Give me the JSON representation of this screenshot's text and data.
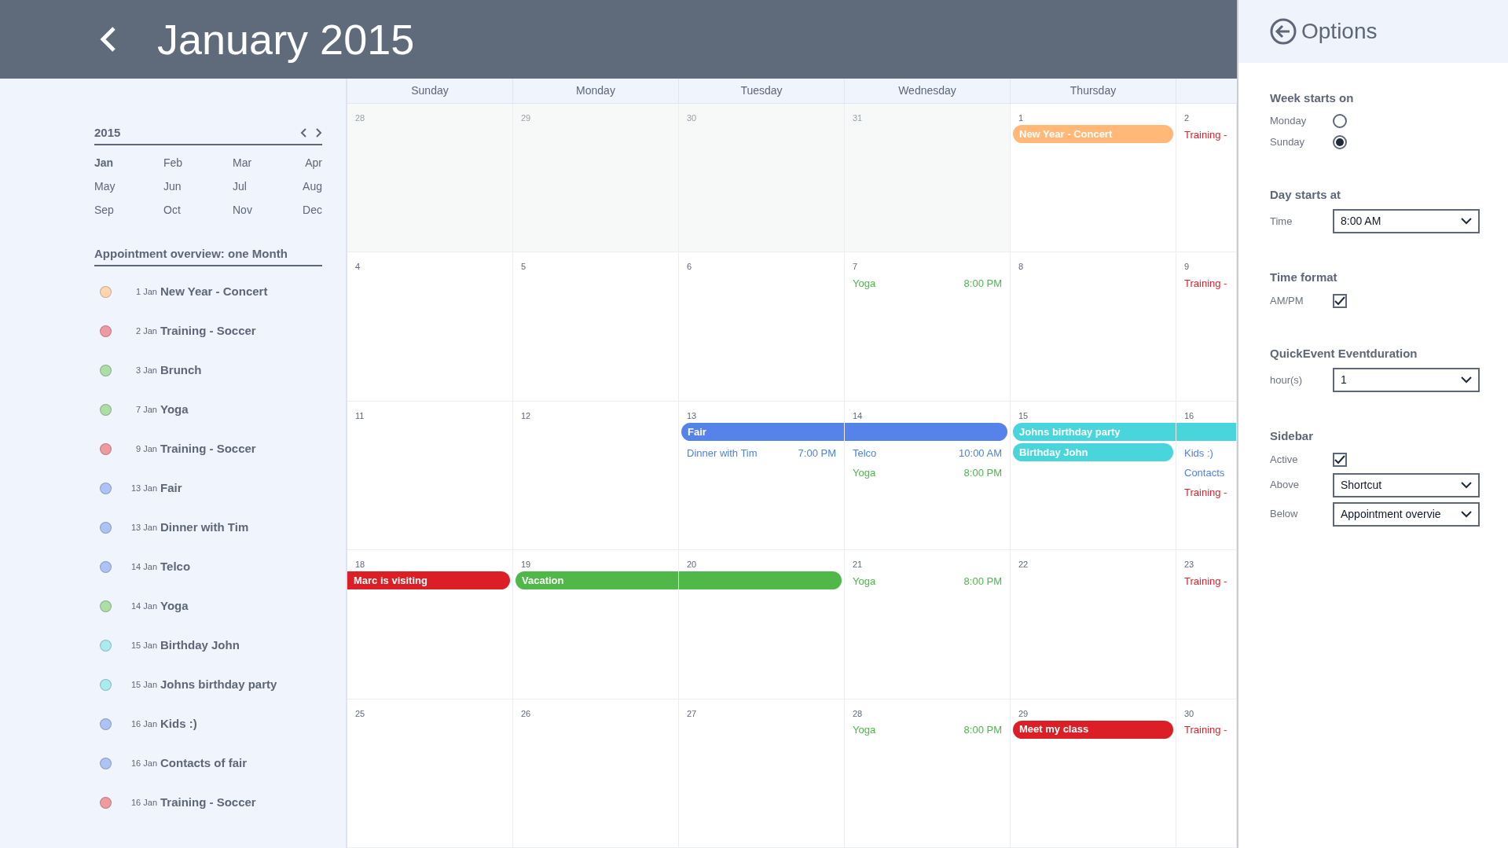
{
  "header": {
    "title": "January 2015"
  },
  "mini_calendar": {
    "year": "2015",
    "months": [
      {
        "label": "Jan",
        "selected": true
      },
      {
        "label": "Feb",
        "selected": false
      },
      {
        "label": "Mar",
        "selected": false
      },
      {
        "label": "Apr",
        "selected": false
      },
      {
        "label": "May",
        "selected": false
      },
      {
        "label": "Jun",
        "selected": false
      },
      {
        "label": "Jul",
        "selected": false
      },
      {
        "label": "Aug",
        "selected": false
      },
      {
        "label": "Sep",
        "selected": false
      },
      {
        "label": "Oct",
        "selected": false
      },
      {
        "label": "Nov",
        "selected": false
      },
      {
        "label": "Dec",
        "selected": false
      }
    ]
  },
  "overview": {
    "title": "Appointment overview: one Month",
    "items": [
      {
        "date": "1 Jan",
        "title": "New Year - Concert",
        "color": "#ffd6ad"
      },
      {
        "date": "2 Jan",
        "title": "Training - Soccer",
        "color": "#ef9aa0"
      },
      {
        "date": "3 Jan",
        "title": "Brunch",
        "color": "#acdea6"
      },
      {
        "date": "7 Jan",
        "title": "Yoga",
        "color": "#acdea6"
      },
      {
        "date": "9 Jan",
        "title": "Training - Soccer",
        "color": "#ef9aa0"
      },
      {
        "date": "13 Jan",
        "title": "Fair",
        "color": "#adc3f6"
      },
      {
        "date": "13 Jan",
        "title": "Dinner with Tim",
        "color": "#adc3f6"
      },
      {
        "date": "14 Jan",
        "title": "Telco",
        "color": "#adc3f6"
      },
      {
        "date": "14 Jan",
        "title": "Yoga",
        "color": "#acdea6"
      },
      {
        "date": "15 Jan",
        "title": "Birthday John",
        "color": "#a9ebee"
      },
      {
        "date": "15 Jan",
        "title": "Johns birthday party",
        "color": "#a9ebee"
      },
      {
        "date": "16 Jan",
        "title": "Kids :)",
        "color": "#adc3f6"
      },
      {
        "date": "16 Jan",
        "title": "Contacts of fair",
        "color": "#adc3f6"
      },
      {
        "date": "16 Jan",
        "title": "Training - Soccer",
        "color": "#ef9aa0"
      }
    ]
  },
  "calendar": {
    "weekdays": [
      "Sunday",
      "Monday",
      "Tuesday",
      "Wednesday",
      "Thursday"
    ],
    "weeks": [
      {
        "days": [
          {
            "number": "28",
            "outside": true
          },
          {
            "number": "29",
            "outside": true
          },
          {
            "number": "30",
            "outside": true
          },
          {
            "number": "31",
            "outside": true
          },
          {
            "number": "1",
            "outside": false,
            "events": [
              {
                "kind": "bar",
                "title": "New Year - Concert",
                "color": "#ffb877",
                "open_start": false,
                "open_end": false
              }
            ]
          },
          {
            "number": "2",
            "outside": false,
            "events": [
              {
                "kind": "timed",
                "title": "Training -",
                "color": "#e0202a"
              }
            ]
          }
        ]
      },
      {
        "days": [
          {
            "number": "4",
            "outside": false
          },
          {
            "number": "5",
            "outside": false
          },
          {
            "number": "6",
            "outside": false
          },
          {
            "number": "7",
            "outside": false,
            "events": [
              {
                "kind": "timed",
                "title": "Yoga",
                "time": "8:00 PM",
                "color": "#4cb848"
              }
            ]
          },
          {
            "number": "8",
            "outside": false
          },
          {
            "number": "9",
            "outside": false,
            "events": [
              {
                "kind": "timed",
                "title": "Training -",
                "color": "#e0202a"
              }
            ]
          }
        ]
      },
      {
        "days": [
          {
            "number": "11",
            "outside": false
          },
          {
            "number": "12",
            "outside": false
          },
          {
            "number": "13",
            "outside": false,
            "events": [
              {
                "kind": "bar",
                "title": "Fair",
                "color": "#5583ea",
                "open_start": false,
                "open_end": true
              },
              {
                "kind": "timed",
                "title": "Dinner with Tim",
                "time": "7:00 PM",
                "color": "#4f7fe6"
              }
            ]
          },
          {
            "number": "14",
            "outside": false,
            "events": [
              {
                "kind": "bar",
                "color": "#5583ea",
                "open_start": true,
                "open_end": false
              },
              {
                "kind": "timed",
                "title": "Telco",
                "time": "10:00 AM",
                "color": "#4f7fe6"
              },
              {
                "kind": "timed",
                "title": "Yoga",
                "time": "8:00 PM",
                "color": "#4cb848"
              }
            ]
          },
          {
            "number": "15",
            "outside": false,
            "events": [
              {
                "kind": "bar",
                "title": "Johns birthday party",
                "color": "#48d6dc",
                "open_start": false,
                "open_end": true
              },
              {
                "kind": "bar",
                "title": "Birthday John",
                "color": "#48d6dc",
                "open_start": false,
                "open_end": false
              }
            ]
          },
          {
            "number": "16",
            "outside": false,
            "events": [
              {
                "kind": "bar",
                "color": "#48d6dc",
                "open_start": true,
                "open_end": true
              },
              {
                "kind": "timed",
                "title": "Kids :)",
                "color": "#4f7fe6"
              },
              {
                "kind": "timed",
                "title": "Contacts",
                "color": "#4f7fe6"
              },
              {
                "kind": "timed",
                "title": "Training -",
                "color": "#e0202a"
              }
            ]
          }
        ]
      },
      {
        "days": [
          {
            "number": "18",
            "outside": false,
            "events": [
              {
                "kind": "bar",
                "title": "Marc is visiting",
                "color": "#dc1f26",
                "open_start": true,
                "open_end": false
              }
            ]
          },
          {
            "number": "19",
            "outside": false,
            "events": [
              {
                "kind": "bar",
                "title": "Vacation",
                "color": "#50b848",
                "open_start": false,
                "open_end": true
              }
            ]
          },
          {
            "number": "20",
            "outside": false,
            "events": [
              {
                "kind": "bar",
                "color": "#50b848",
                "open_start": true,
                "open_end": false
              }
            ]
          },
          {
            "number": "21",
            "outside": false,
            "events": [
              {
                "kind": "timed",
                "title": "Yoga",
                "time": "8:00 PM",
                "color": "#4cb848"
              }
            ]
          },
          {
            "number": "22",
            "outside": false
          },
          {
            "number": "23",
            "outside": false,
            "events": [
              {
                "kind": "timed",
                "title": "Training -",
                "color": "#e0202a"
              }
            ]
          }
        ]
      },
      {
        "days": [
          {
            "number": "25",
            "outside": false
          },
          {
            "number": "26",
            "outside": false
          },
          {
            "number": "27",
            "outside": false
          },
          {
            "number": "28",
            "outside": false,
            "events": [
              {
                "kind": "timed",
                "title": "Yoga",
                "time": "8:00 PM",
                "color": "#4cb848"
              }
            ]
          },
          {
            "number": "29",
            "outside": false,
            "events": [
              {
                "kind": "bar",
                "title": "Meet my class",
                "color": "#dc1f26",
                "open_start": false,
                "open_end": false
              }
            ]
          },
          {
            "number": "30",
            "outside": false,
            "events": [
              {
                "kind": "timed",
                "title": "Training -",
                "color": "#e0202a"
              }
            ]
          }
        ]
      }
    ]
  },
  "options": {
    "title": "Options",
    "sections": [
      {
        "heading": "Week starts on",
        "rows": [
          {
            "kind": "radio",
            "label": "Monday",
            "selected": false
          },
          {
            "kind": "radio",
            "label": "Sunday",
            "selected": true
          }
        ]
      },
      {
        "heading": "Day starts at",
        "rows": [
          {
            "kind": "select",
            "label": "Time",
            "value": "8:00 AM"
          }
        ]
      },
      {
        "heading": "Time format",
        "rows": [
          {
            "kind": "checkbox",
            "label": "AM/PM",
            "checked": true
          }
        ]
      },
      {
        "heading": "QuickEvent Eventduration",
        "rows": [
          {
            "kind": "select",
            "label": "hour(s)",
            "value": "1"
          }
        ]
      },
      {
        "heading": "Sidebar",
        "rows": [
          {
            "kind": "checkbox",
            "label": "Active",
            "checked": true
          },
          {
            "kind": "select",
            "label": "Above",
            "value": "Shortcut"
          },
          {
            "kind": "select",
            "label": "Below",
            "value": "Appointment overvie"
          }
        ]
      }
    ]
  }
}
